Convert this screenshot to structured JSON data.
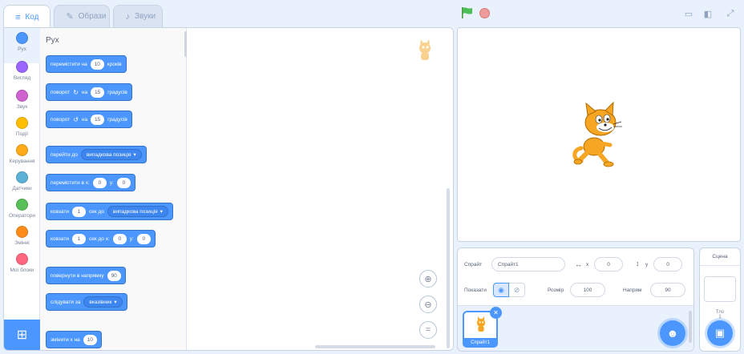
{
  "tabs": [
    {
      "label": "Код",
      "icon": "code-icon"
    },
    {
      "label": "Образи",
      "icon": "brush-icon"
    },
    {
      "label": "Звуки",
      "icon": "sound-icon"
    }
  ],
  "categories": [
    {
      "label": "Рух",
      "color": "#4c97ff"
    },
    {
      "label": "Вигляд",
      "color": "#9966ff"
    },
    {
      "label": "Звук",
      "color": "#cf63cf"
    },
    {
      "label": "Події",
      "color": "#ffbf00"
    },
    {
      "label": "Керування",
      "color": "#ffab19"
    },
    {
      "label": "Датчики",
      "color": "#5cb1d6"
    },
    {
      "label": "Оператори",
      "color": "#59c059"
    },
    {
      "label": "Змінні",
      "color": "#ff8c1a"
    },
    {
      "label": "Мої блоки",
      "color": "#ff6680"
    }
  ],
  "palette": {
    "title": "Рух",
    "blocks": [
      {
        "text1": "перемістити на",
        "num1": "10",
        "text2": "кроків"
      },
      {
        "text1": "поворот",
        "icon": "↻",
        "text2": "на",
        "num1": "15",
        "text3": "градусів"
      },
      {
        "text1": "поворот",
        "icon": "↺",
        "text2": "на",
        "num1": "15",
        "text3": "градусів"
      },
      {
        "text1": "перейти до",
        "dropdown": "випадкова позиція"
      },
      {
        "text1": "перемістити в х:",
        "num1": "0",
        "text2": "у:",
        "num2": "0"
      },
      {
        "text1": "ковзати",
        "num1": "1",
        "text2": "сек до",
        "dropdown": "випадкова позиція"
      },
      {
        "text1": "ковзати",
        "num1": "1",
        "text2": "сек до х:",
        "num2": "0",
        "text3": "у:",
        "num3": "0"
      },
      {
        "text1": "повернути в напрямку",
        "num1": "90"
      },
      {
        "text1": "слідувати за",
        "dropdown": "вказівник"
      },
      {
        "text1": "змінити х на",
        "num1": "10"
      }
    ]
  },
  "sprite_info": {
    "sprite_label": "Спрайт",
    "sprite_name": "Спрайт1",
    "x_label": "x",
    "x_value": "0",
    "y_label": "y",
    "y_value": "0",
    "show_label": "Показати",
    "size_label": "Розмір",
    "size_value": "100",
    "direction_label": "Напрям",
    "direction_value": "90"
  },
  "sprite_list": [
    {
      "name": "Спрайт1"
    }
  ],
  "stage_pane": {
    "header": "Сцена",
    "backdrops_label": "Тло",
    "backdrops_count": "1"
  },
  "colors": {
    "accent": "#4c97ff",
    "motion": "#4c97ff",
    "green_flag": "#4cbf56",
    "stop": "#ec9c9c"
  }
}
